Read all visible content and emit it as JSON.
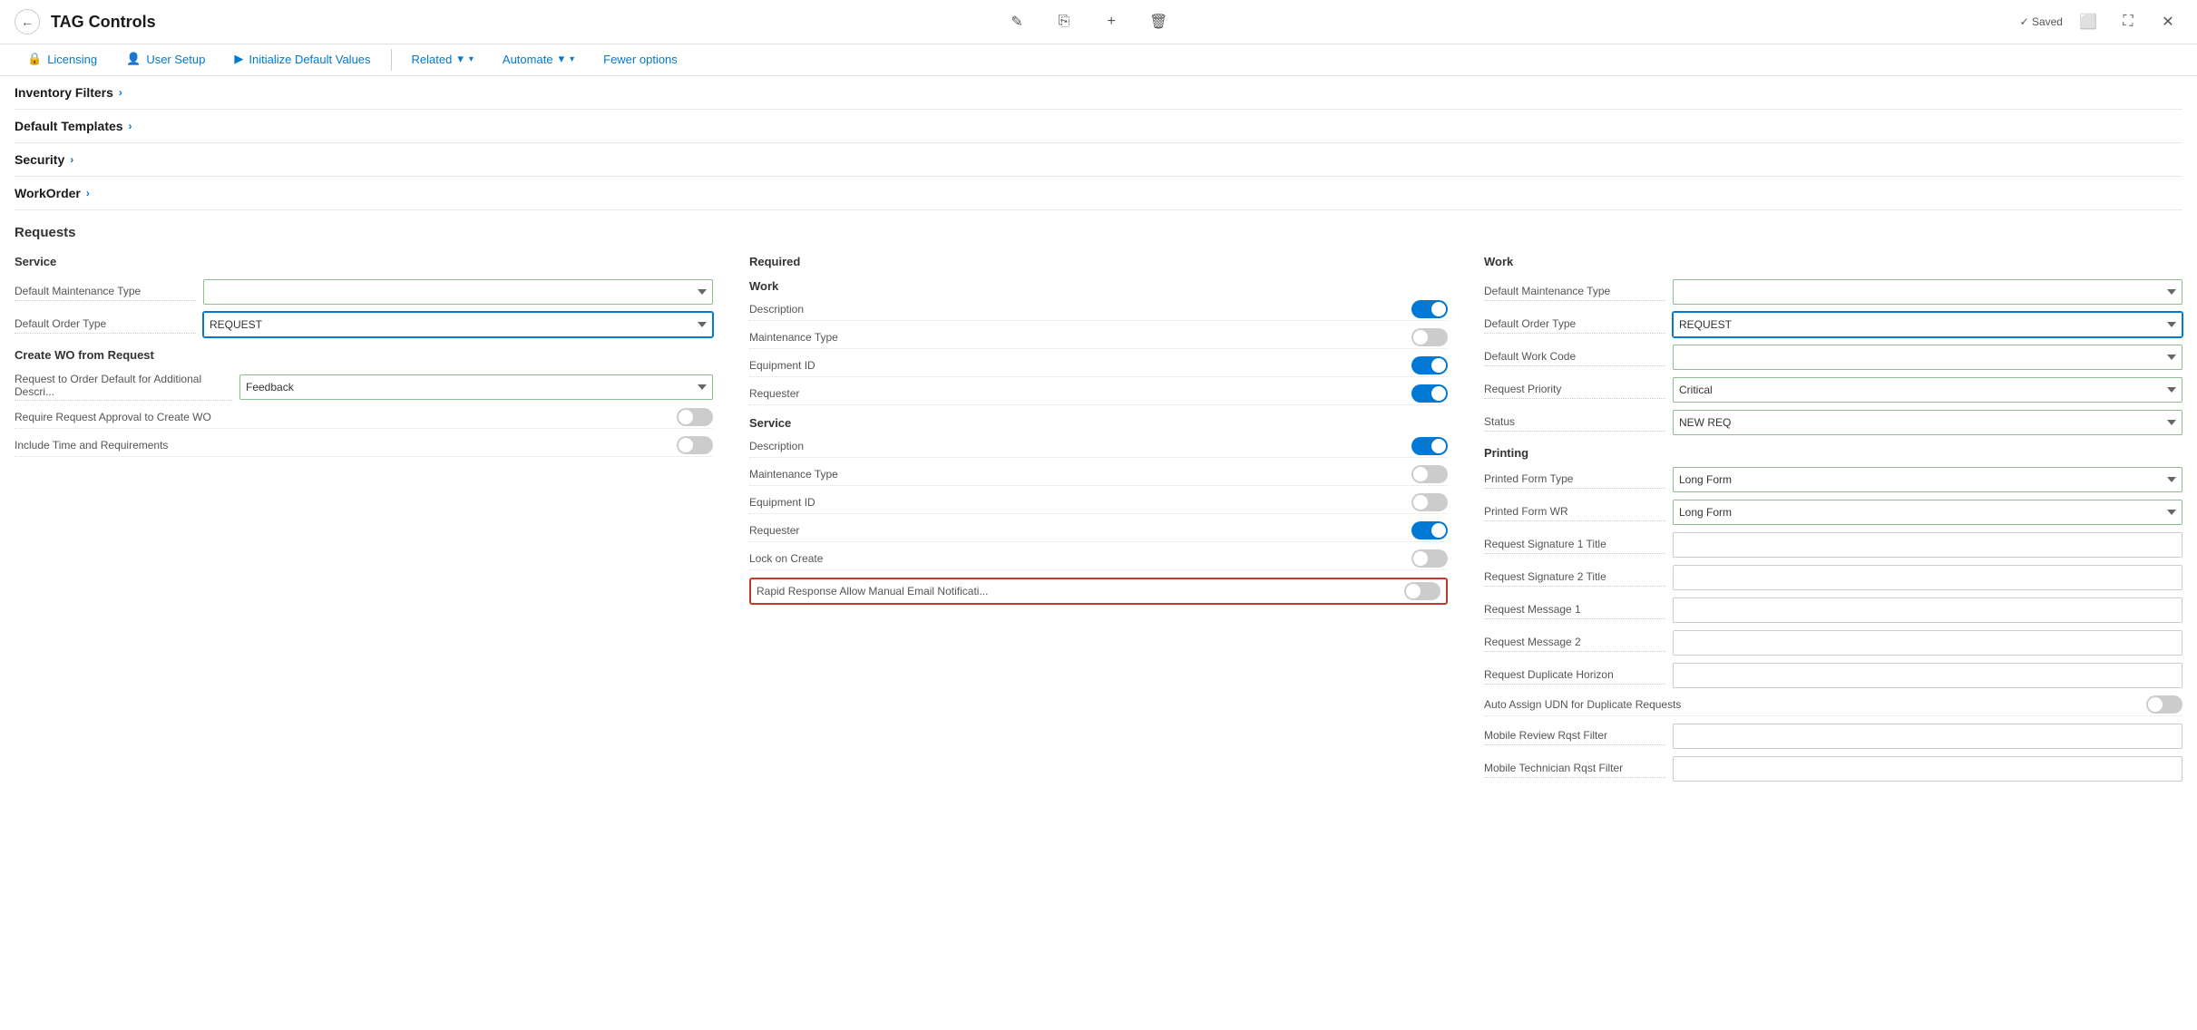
{
  "topbar": {
    "title": "TAG Controls",
    "saved_label": "Saved",
    "back_icon": "←",
    "edit_icon": "✎",
    "share_icon": "⎘",
    "add_icon": "+",
    "delete_icon": "🗑"
  },
  "nav": {
    "tabs": [
      {
        "id": "licensing",
        "label": "Licensing",
        "icon": "🔒"
      },
      {
        "id": "user-setup",
        "label": "User Setup",
        "icon": "👤"
      },
      {
        "id": "init-defaults",
        "label": "Initialize Default Values",
        "icon": "▶"
      },
      {
        "id": "related",
        "label": "Related",
        "dropdown": true
      },
      {
        "id": "automate",
        "label": "Automate",
        "dropdown": true
      },
      {
        "id": "fewer",
        "label": "Fewer options"
      }
    ]
  },
  "sections": {
    "inventory_filters": "Inventory Filters",
    "default_templates": "Default Templates",
    "security": "Security",
    "work_order": "WorkOrder",
    "requests": "Requests"
  },
  "service_col": {
    "title": "Service",
    "fields": {
      "default_maintenance_type_label": "Default Maintenance Type",
      "default_order_type_label": "Default Order Type",
      "default_order_type_value": "REQUEST",
      "create_wo_label": "Create WO from Request",
      "request_to_order_label": "Request to Order Default for Additional Descri...",
      "request_to_order_value": "Feedback",
      "require_approval_label": "Require Request Approval to Create WO",
      "include_time_label": "Include Time and Requirements"
    },
    "toggles": {
      "require_approval": false,
      "include_time": false
    }
  },
  "required_col": {
    "title": "Required",
    "work_subtitle": "Work",
    "service_subtitle": "Service",
    "fields": {
      "description_label": "Description",
      "maintenance_type_label": "Maintenance Type",
      "equipment_id_label": "Equipment ID",
      "requester_label": "Requester",
      "svc_description_label": "Description",
      "svc_maintenance_type_label": "Maintenance Type",
      "svc_equipment_id_label": "Equipment ID",
      "svc_requester_label": "Requester",
      "lock_on_create_label": "Lock on Create",
      "rapid_response_label": "Rapid Response Allow Manual Email Notificati..."
    },
    "toggles": {
      "description": true,
      "maintenance_type": false,
      "equipment_id": true,
      "requester": true,
      "svc_description": true,
      "svc_maintenance_type": false,
      "svc_equipment_id": false,
      "svc_requester": true,
      "lock_on_create": false,
      "rapid_response": false
    }
  },
  "work_col": {
    "title": "Work",
    "printing_subtitle": "Printing",
    "fields": {
      "default_maintenance_type_label": "Default Maintenance Type",
      "default_order_type_label": "Default Order Type",
      "default_order_type_value": "REQUEST",
      "default_work_code_label": "Default Work Code",
      "request_priority_label": "Request Priority",
      "request_priority_value": "Critical",
      "status_label": "Status",
      "status_value": "NEW REQ",
      "printed_form_type_label": "Printed Form Type",
      "printed_form_type_value": "Long Form",
      "printed_form_wr_label": "Printed Form WR",
      "printed_form_wr_value": "Long Form",
      "sig1_title_label": "Request Signature 1 Title",
      "sig2_title_label": "Request Signature 2 Title",
      "msg1_label": "Request Message 1",
      "msg2_label": "Request Message 2",
      "dup_horizon_label": "Request Duplicate Horizon",
      "auto_assign_label": "Auto Assign UDN for Duplicate Requests",
      "mobile_review_label": "Mobile Review Rqst Filter",
      "mobile_tech_label": "Mobile Technician Rqst Filter"
    },
    "toggles": {
      "auto_assign": false
    }
  }
}
